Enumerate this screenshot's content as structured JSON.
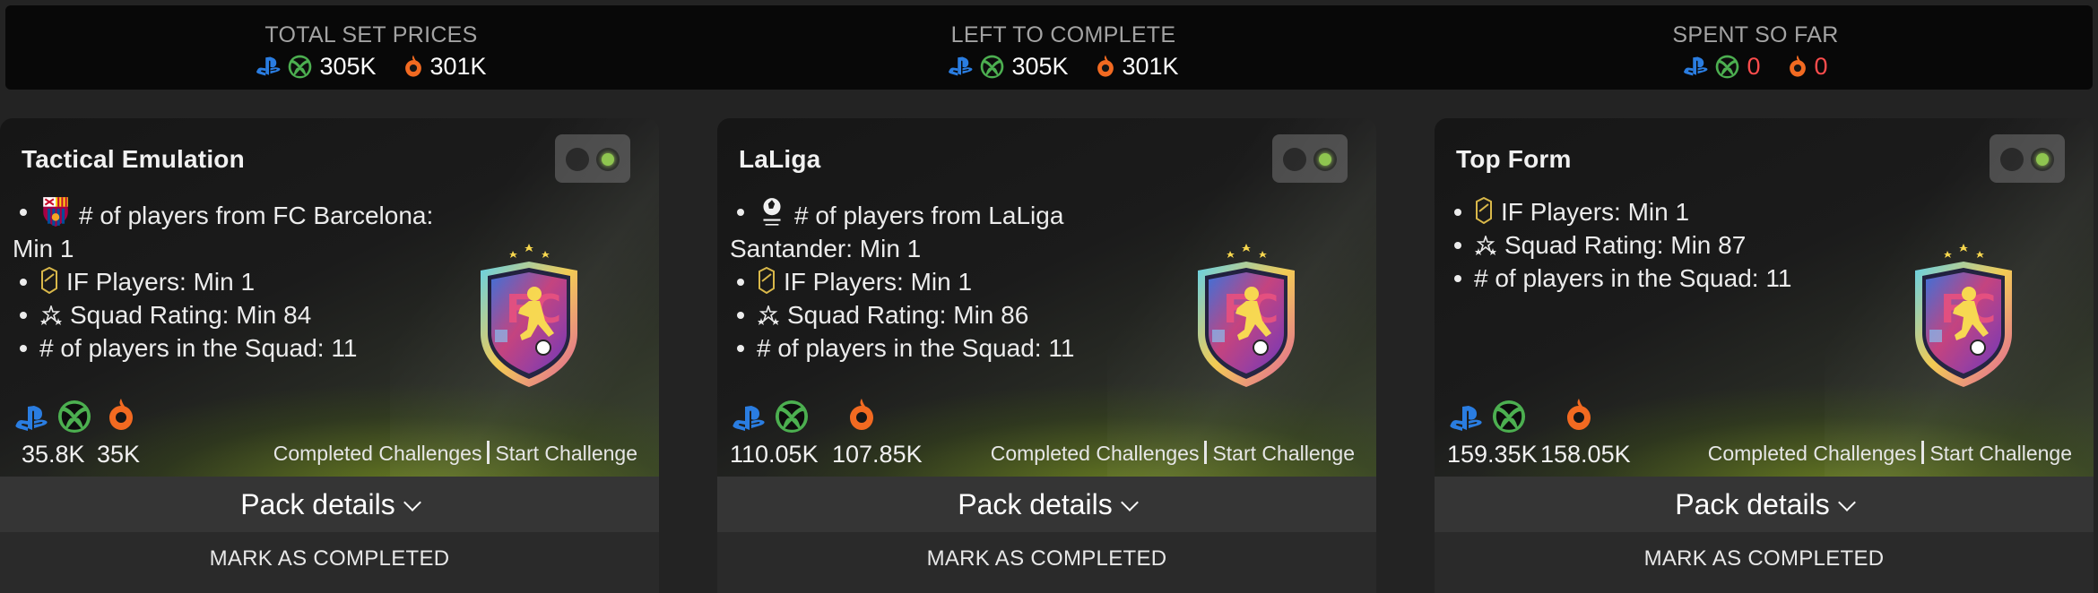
{
  "summary": {
    "total": {
      "title": "TOTAL SET PRICES",
      "console_value": "305K",
      "pc_value": "301K"
    },
    "left": {
      "title": "LEFT TO COMPLETE",
      "console_value": "305K",
      "pc_value": "301K"
    },
    "spent": {
      "title": "SPENT SO FAR",
      "console_value": "0",
      "pc_value": "0"
    }
  },
  "colors": {
    "playstation": "#1f6fd1",
    "xbox": "#4caf50",
    "origin": "#f26a21",
    "spent_red": "#ff4d4d",
    "toggle_on": "#8bc34a"
  },
  "icons": [
    "playstation-icon",
    "xbox-icon",
    "origin-icon",
    "fc-barcelona-crest-icon",
    "laliga-logo-icon",
    "if-card-icon",
    "squad-rating-icon",
    "sbc-badge-icon"
  ],
  "cards": [
    {
      "title": "Tactical Emulation",
      "requirements": [
        "# of players from FC Barcelona:",
        "Min 1",
        "IF Players: Min 1",
        "Squad Rating: Min 84",
        "# of players in the Squad: 11"
      ],
      "console_price": "35.8K",
      "pc_price": "35K",
      "completed_link": "Completed Challenges",
      "start_link": "Start Challenge",
      "pack_label": "Pack details",
      "mark_label": "MARK AS COMPLETED"
    },
    {
      "title": "LaLiga",
      "requirements": [
        "# of players from LaLiga",
        "Santander: Min 1",
        "IF Players: Min 1",
        "Squad Rating: Min 86",
        "# of players in the Squad: 11"
      ],
      "console_price": "110.05K",
      "pc_price": "107.85K",
      "completed_link": "Completed Challenges",
      "start_link": "Start Challenge",
      "pack_label": "Pack details",
      "mark_label": "MARK AS COMPLETED"
    },
    {
      "title": "Top Form",
      "requirements": [
        "IF Players: Min 1",
        "Squad Rating: Min 87",
        "# of players in the Squad: 11"
      ],
      "console_price": "159.35K",
      "pc_price": "158.05K",
      "completed_link": "Completed Challenges",
      "start_link": "Start Challenge",
      "pack_label": "Pack details",
      "mark_label": "MARK AS COMPLETED"
    }
  ]
}
